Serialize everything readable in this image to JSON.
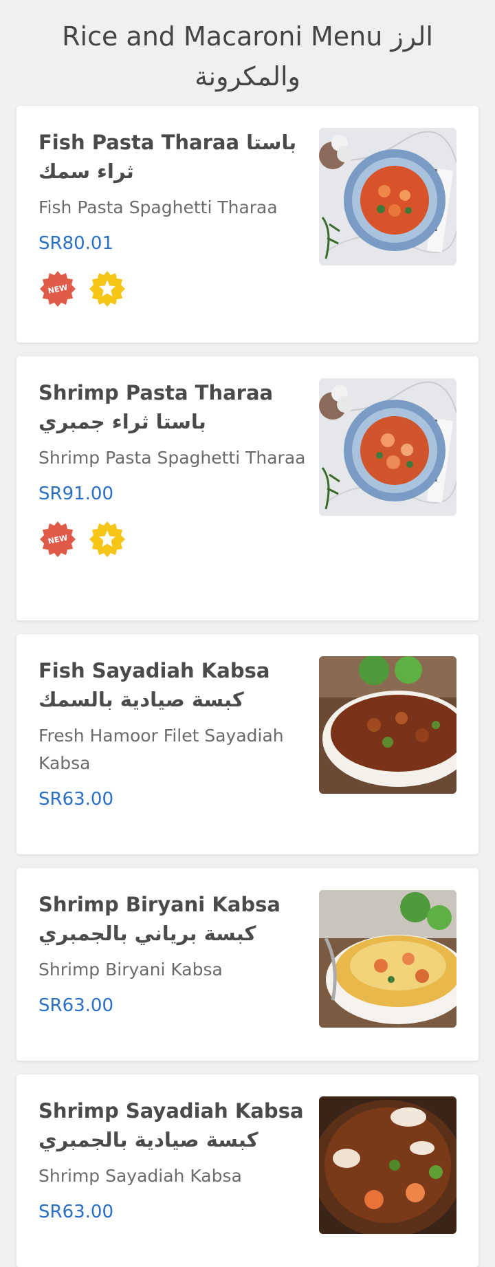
{
  "page": {
    "title": "Rice and Macaroni Menu الرز والمكرونة"
  },
  "items": [
    {
      "name": "Fish Pasta Tharaa باستا ثراء سمك",
      "desc": "Fish Pasta Spaghetti Tharaa",
      "price": "SR80.01",
      "badge_new": "NEW",
      "image": "fish-pasta-image"
    },
    {
      "name": "Shrimp Pasta Tharaa باستا ثراء جمبري",
      "desc": "Shrimp Pasta Spaghetti Tharaa",
      "price": "SR91.00",
      "badge_new": "NEW",
      "image": "shrimp-pasta-image"
    },
    {
      "name": "Fish Sayadiah Kabsa كبسة صيادية بالسمك",
      "desc": "Fresh Hamoor Filet Sayadiah Kabsa",
      "price": "SR63.00",
      "image": "fish-sayadiah-image"
    },
    {
      "name": "Shrimp Biryani Kabsa كبسة برياني بالجمبري",
      "desc": "Shrimp Biryani Kabsa",
      "price": "SR63.00",
      "image": "shrimp-biryani-image"
    },
    {
      "name": "Shrimp Sayadiah Kabsa كبسة صيادية بالجمبري",
      "desc": "Shrimp Sayadiah Kabsa",
      "price": "SR63.00",
      "image": "shrimp-sayadiah-image"
    }
  ],
  "colors": {
    "price": "#2a6fc4",
    "badge_new": "#e05a4a",
    "badge_star": "#f5c518",
    "card_bg": "#ffffff",
    "page_bg": "#f0f0f0"
  }
}
